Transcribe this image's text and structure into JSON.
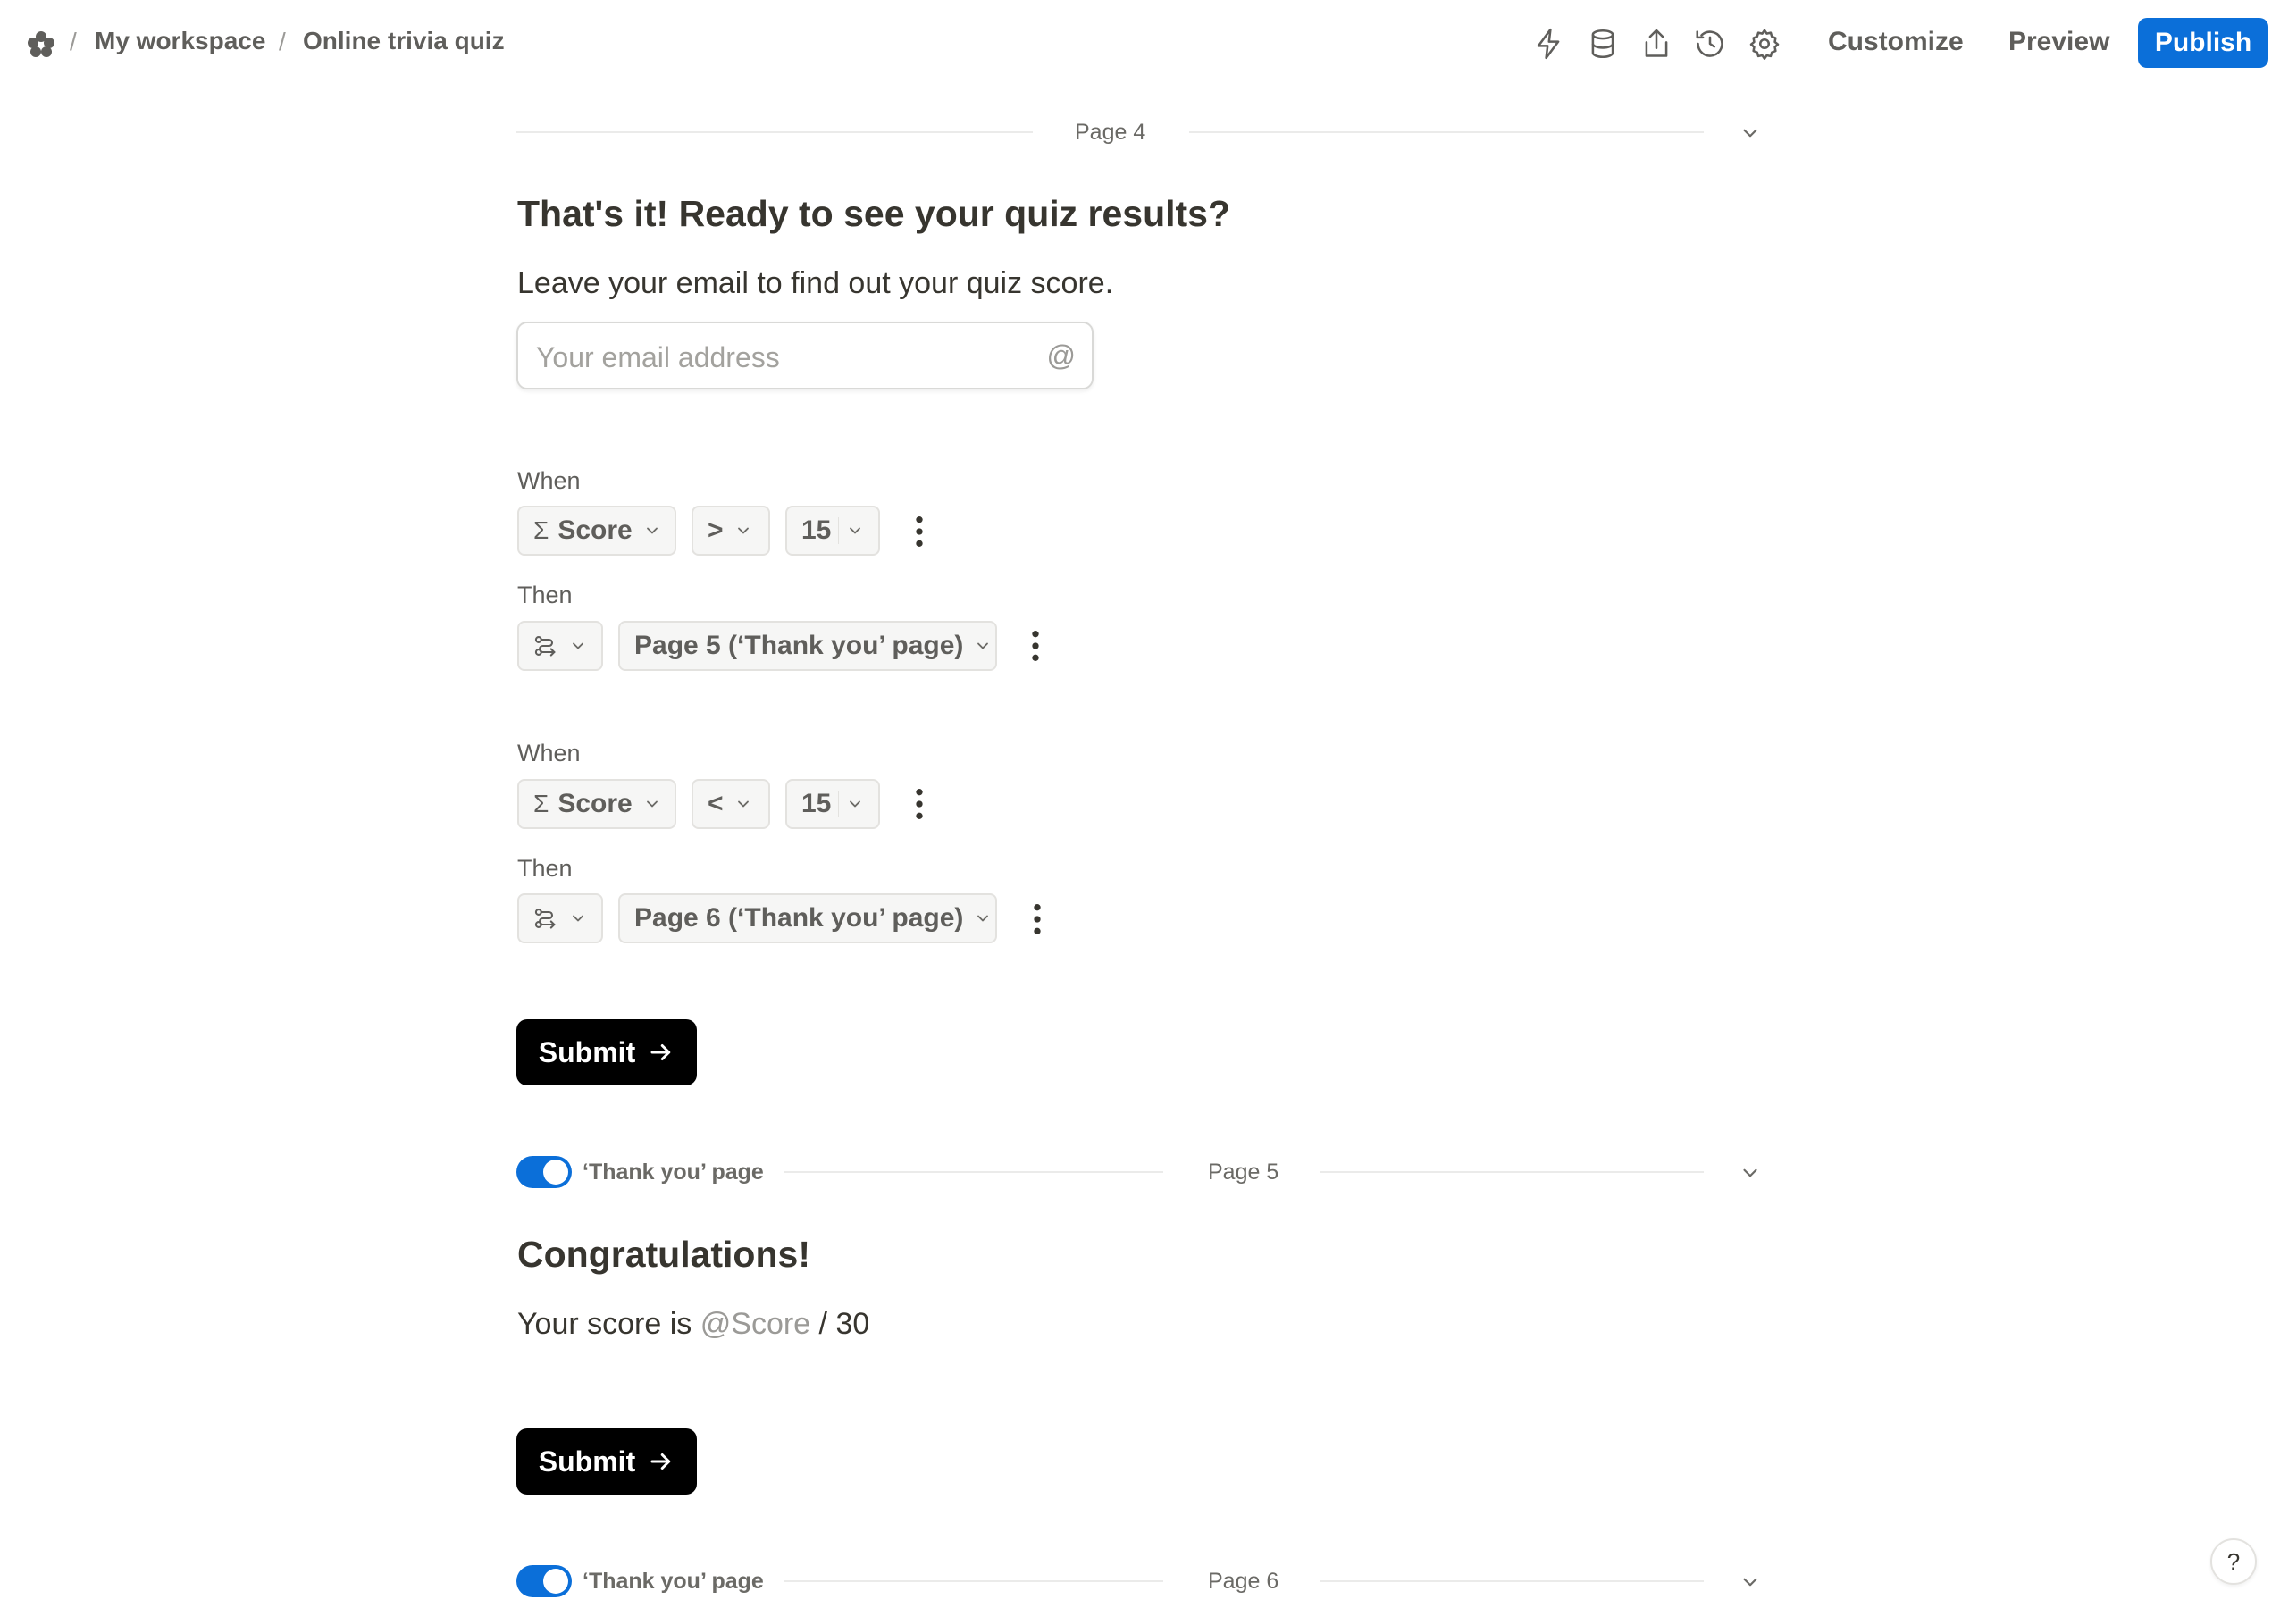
{
  "header": {
    "breadcrumb": [
      "My workspace",
      "Online trivia quiz"
    ],
    "separator": "/",
    "tool_icons": [
      "lightning-icon",
      "database-icon",
      "share-icon",
      "history-icon",
      "gear-icon"
    ],
    "customize_label": "Customize",
    "preview_label": "Preview",
    "publish_label": "Publish",
    "accent_color": "#0b6fd9"
  },
  "page4": {
    "label": "Page 4",
    "title": "That's it! Ready to see your quiz results?",
    "description": "Leave your email to find out your quiz score.",
    "email_placeholder": "Your email address",
    "email_icon": "@",
    "rules": [
      {
        "when_label": "When",
        "field": "Score",
        "field_icon": "Σ",
        "operator": ">",
        "value": "15",
        "then_label": "Then",
        "target": "Page 5 (‘Thank you’ page)"
      },
      {
        "when_label": "When",
        "field": "Score",
        "field_icon": "Σ",
        "operator": "<",
        "value": "15",
        "then_label": "Then",
        "target": "Page 6 (‘Thank you’ page)"
      }
    ],
    "submit_label": "Submit"
  },
  "page5": {
    "toggle_label": "‘Thank you’ page",
    "toggle_on": true,
    "label": "Page 5",
    "title": "Congratulations!",
    "score_prefix": "Your score is",
    "score_mention": "@Score",
    "score_suffix": "/ 30",
    "submit_label": "Submit"
  },
  "page6": {
    "toggle_label": "‘Thank you’ page",
    "toggle_on": true,
    "label": "Page 6"
  },
  "help_label": "?"
}
